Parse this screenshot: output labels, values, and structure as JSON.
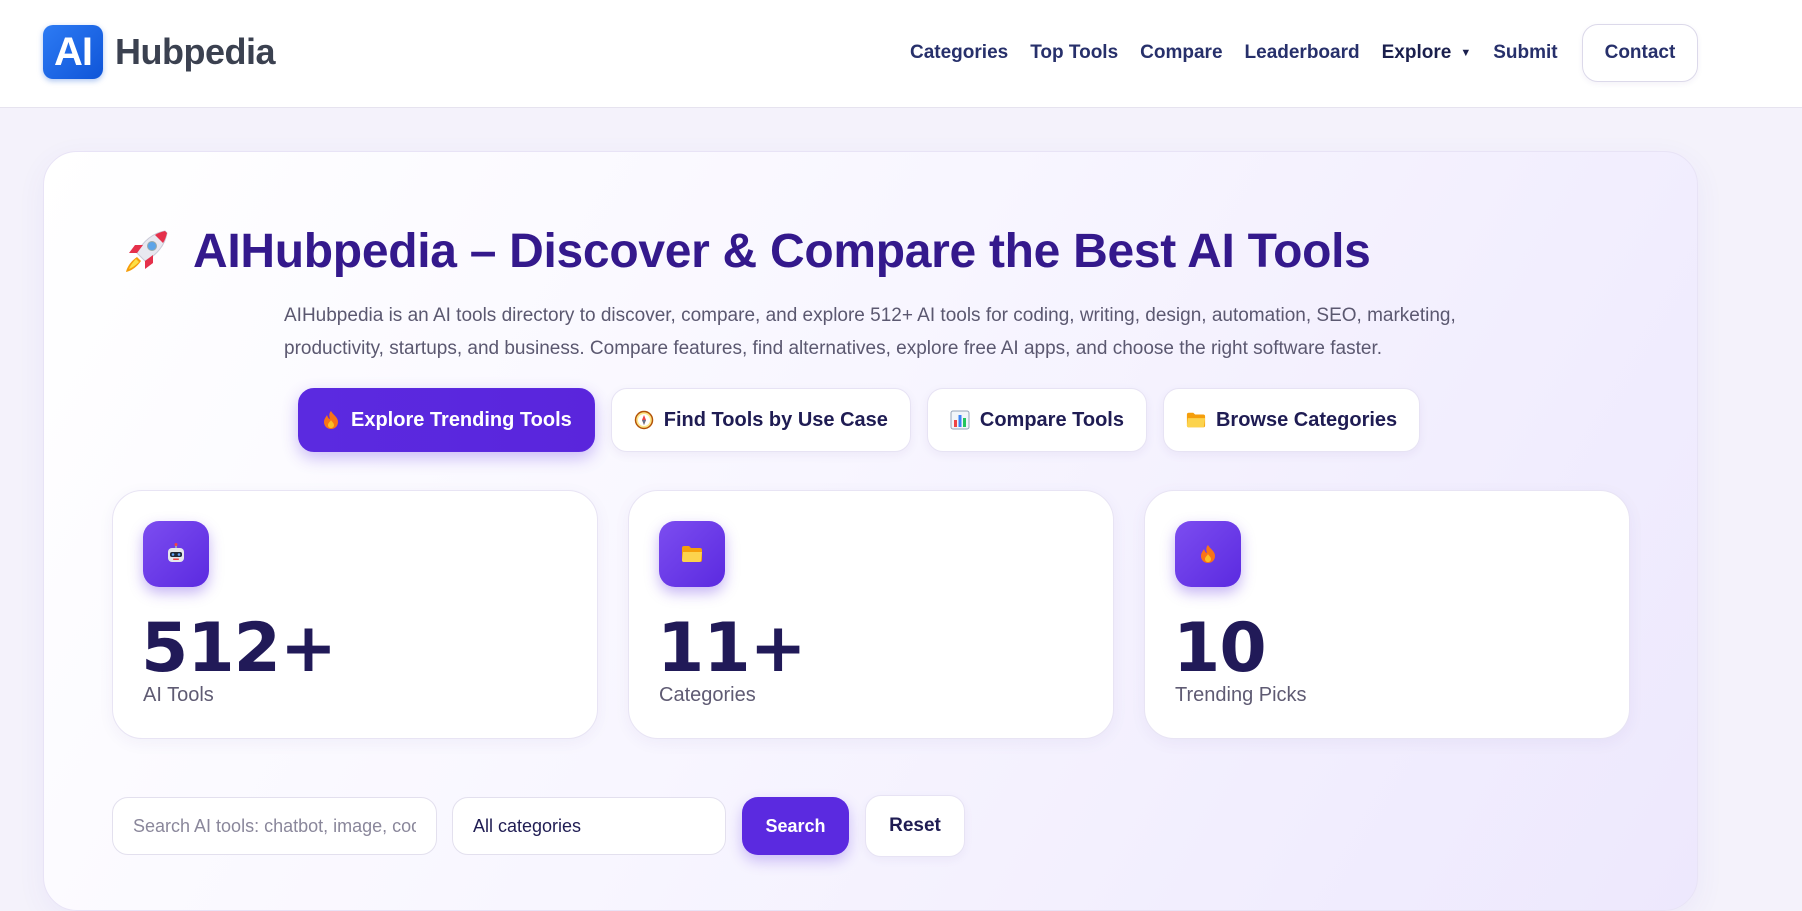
{
  "brand": {
    "badge": "AI",
    "name": "Hubpedia"
  },
  "nav": {
    "items": [
      "Categories",
      "Top Tools",
      "Compare",
      "Leaderboard"
    ],
    "explore": "Explore",
    "submit": "Submit",
    "contact": "Contact"
  },
  "hero": {
    "title": "AIHubpedia – Discover & Compare the Best AI Tools",
    "description": "AIHubpedia is an AI tools directory to discover, compare, and explore 512+ AI tools for coding, writing, design, automation, SEO, marketing, productivity, startups, and business. Compare features, find alternatives, explore free AI apps, and choose the right software faster.",
    "ctas": [
      {
        "label": "Explore Trending Tools",
        "icon": "fire-icon"
      },
      {
        "label": "Find Tools by Use Case",
        "icon": "compass-icon"
      },
      {
        "label": "Compare Tools",
        "icon": "bar-chart-icon"
      },
      {
        "label": "Browse Categories",
        "icon": "folder-icon"
      }
    ]
  },
  "stats": [
    {
      "value": "512+",
      "label": "AI Tools",
      "icon": "robot-icon"
    },
    {
      "value": "11+",
      "label": "Categories",
      "icon": "folder-icon"
    },
    {
      "value": "10",
      "label": "Trending Picks",
      "icon": "fire-icon"
    }
  ],
  "search": {
    "placeholder": "Search AI tools: chatbot, image, code...",
    "category_value": "All categories",
    "search_label": "Search",
    "reset_label": "Reset"
  },
  "colors": {
    "accent": "#5b2ae0",
    "title": "#34198c",
    "logo": "#1a62e6"
  }
}
